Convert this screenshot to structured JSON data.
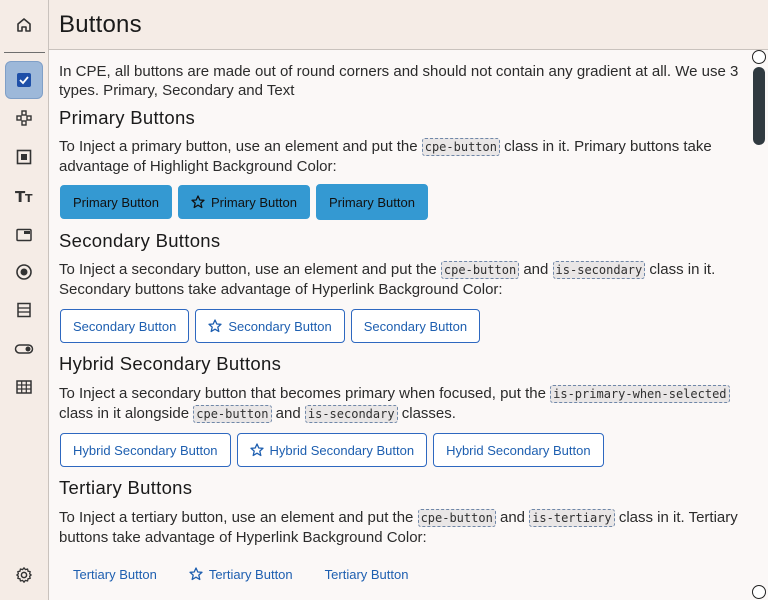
{
  "header": {
    "title": "Buttons"
  },
  "intro": "In CPE, all buttons are made out of round corners and should not contain any gradient at all. We use 3 types. Primary, Secondary and Text",
  "sections": {
    "primary": {
      "title": "Primary Buttons",
      "text_a": "To Inject a primary button, use an element and put the ",
      "code_a": "cpe-button",
      "text_b": " class in it. Primary buttons take advantage of Highlight Background Color:",
      "buttons": [
        "Primary Button",
        "Primary Button",
        "Primary Button"
      ]
    },
    "secondary": {
      "title": "Secondary Buttons",
      "text_a": "To Inject a secondary button, use an element and put the ",
      "code_a": "cpe-button",
      "text_b": " and ",
      "code_b": "is-secondary",
      "text_c": " class in it. Secondary buttons take advantage of Hyperlink Background Color:",
      "buttons": [
        "Secondary Button",
        "Secondary Button",
        "Secondary Button"
      ]
    },
    "hybrid": {
      "title": "Hybrid Secondary Buttons",
      "text_a": "To Inject a secondary button that becomes primary when focused, put the ",
      "code_a": "is-primary-when-selected",
      "text_b": " class in it alongside ",
      "code_b": "cpe-button",
      "text_c": " and ",
      "code_c": "is-secondary",
      "text_d": " classes.",
      "buttons": [
        "Hybrid Secondary Button",
        "Hybrid Secondary Button",
        "Hybrid Secondary Button"
      ]
    },
    "tertiary": {
      "title": "Tertiary Buttons",
      "text_a": "To Inject a tertiary button, use an element and put the ",
      "code_a": "cpe-button",
      "text_b": " and ",
      "code_b": "is-tertiary",
      "text_c": " class in it. Tertiary buttons take advantage of Hyperlink Background Color:",
      "buttons": [
        "Tertiary Button",
        "Tertiary Button",
        "Tertiary Button"
      ]
    }
  },
  "sidebar": {
    "items": [
      "home-icon",
      "checkbox-icon",
      "nodes-icon",
      "square-icon",
      "text-size-icon",
      "window-icon",
      "radio-icon",
      "list-icon",
      "toggle-icon",
      "table-icon",
      "gear-icon"
    ],
    "active": "checkbox-icon"
  },
  "colors": {
    "primary": "#3499d2",
    "link": "#1e5fb0",
    "sidebar_active": "#9db8d9",
    "background": "#fbf8f7",
    "header": "#f5ece6"
  }
}
